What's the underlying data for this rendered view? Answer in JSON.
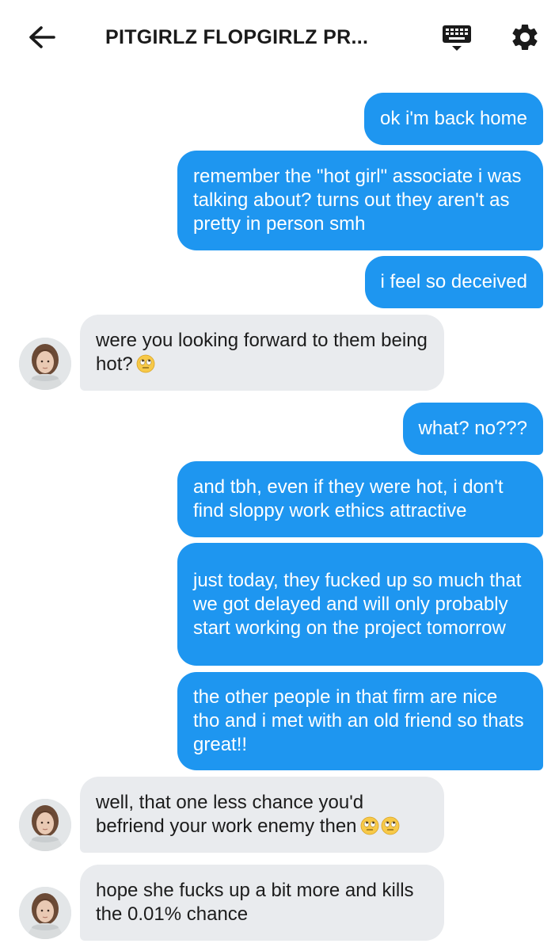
{
  "header": {
    "title": "PITGIRLZ FLOPGIRLZ PR...",
    "back_icon": "arrow-left-icon",
    "keyboard_icon": "keyboard-icon",
    "settings_icon": "gear-icon"
  },
  "colors": {
    "outgoing_bubble": "#1e96f0",
    "incoming_bubble": "#e9ebee",
    "outgoing_text": "#ffffff",
    "incoming_text": "#1c1c1c"
  },
  "messages": [
    {
      "sender": "me",
      "text": "ok i'm back home"
    },
    {
      "sender": "me",
      "text": "remember the \"hot girl\" associate i was talking about? turns out they aren't as pretty in person smh"
    },
    {
      "sender": "me",
      "text": "i feel so deceived"
    },
    {
      "sender": "other",
      "text": "were you looking forward to them being hot?",
      "emoji": [
        "face-with-rolling-eyes"
      ]
    },
    {
      "sender": "me",
      "text": "what? no???"
    },
    {
      "sender": "me",
      "text": "and tbh, even if they were hot, i don't find sloppy work ethics attractive"
    },
    {
      "sender": "me",
      "text": "just today, they fucked up so much that we got delayed and will only probably start working on the project tomorrow"
    },
    {
      "sender": "me",
      "text": "the other people in that firm are nice tho and i met with an old friend so thats great!!"
    },
    {
      "sender": "other",
      "text": "well, that one less chance you'd befriend your work enemy then",
      "emoji": [
        "face-with-rolling-eyes",
        "face-with-rolling-eyes"
      ]
    },
    {
      "sender": "other",
      "text": "hope she fucks up a bit more and kills the 0.01% chance"
    }
  ]
}
